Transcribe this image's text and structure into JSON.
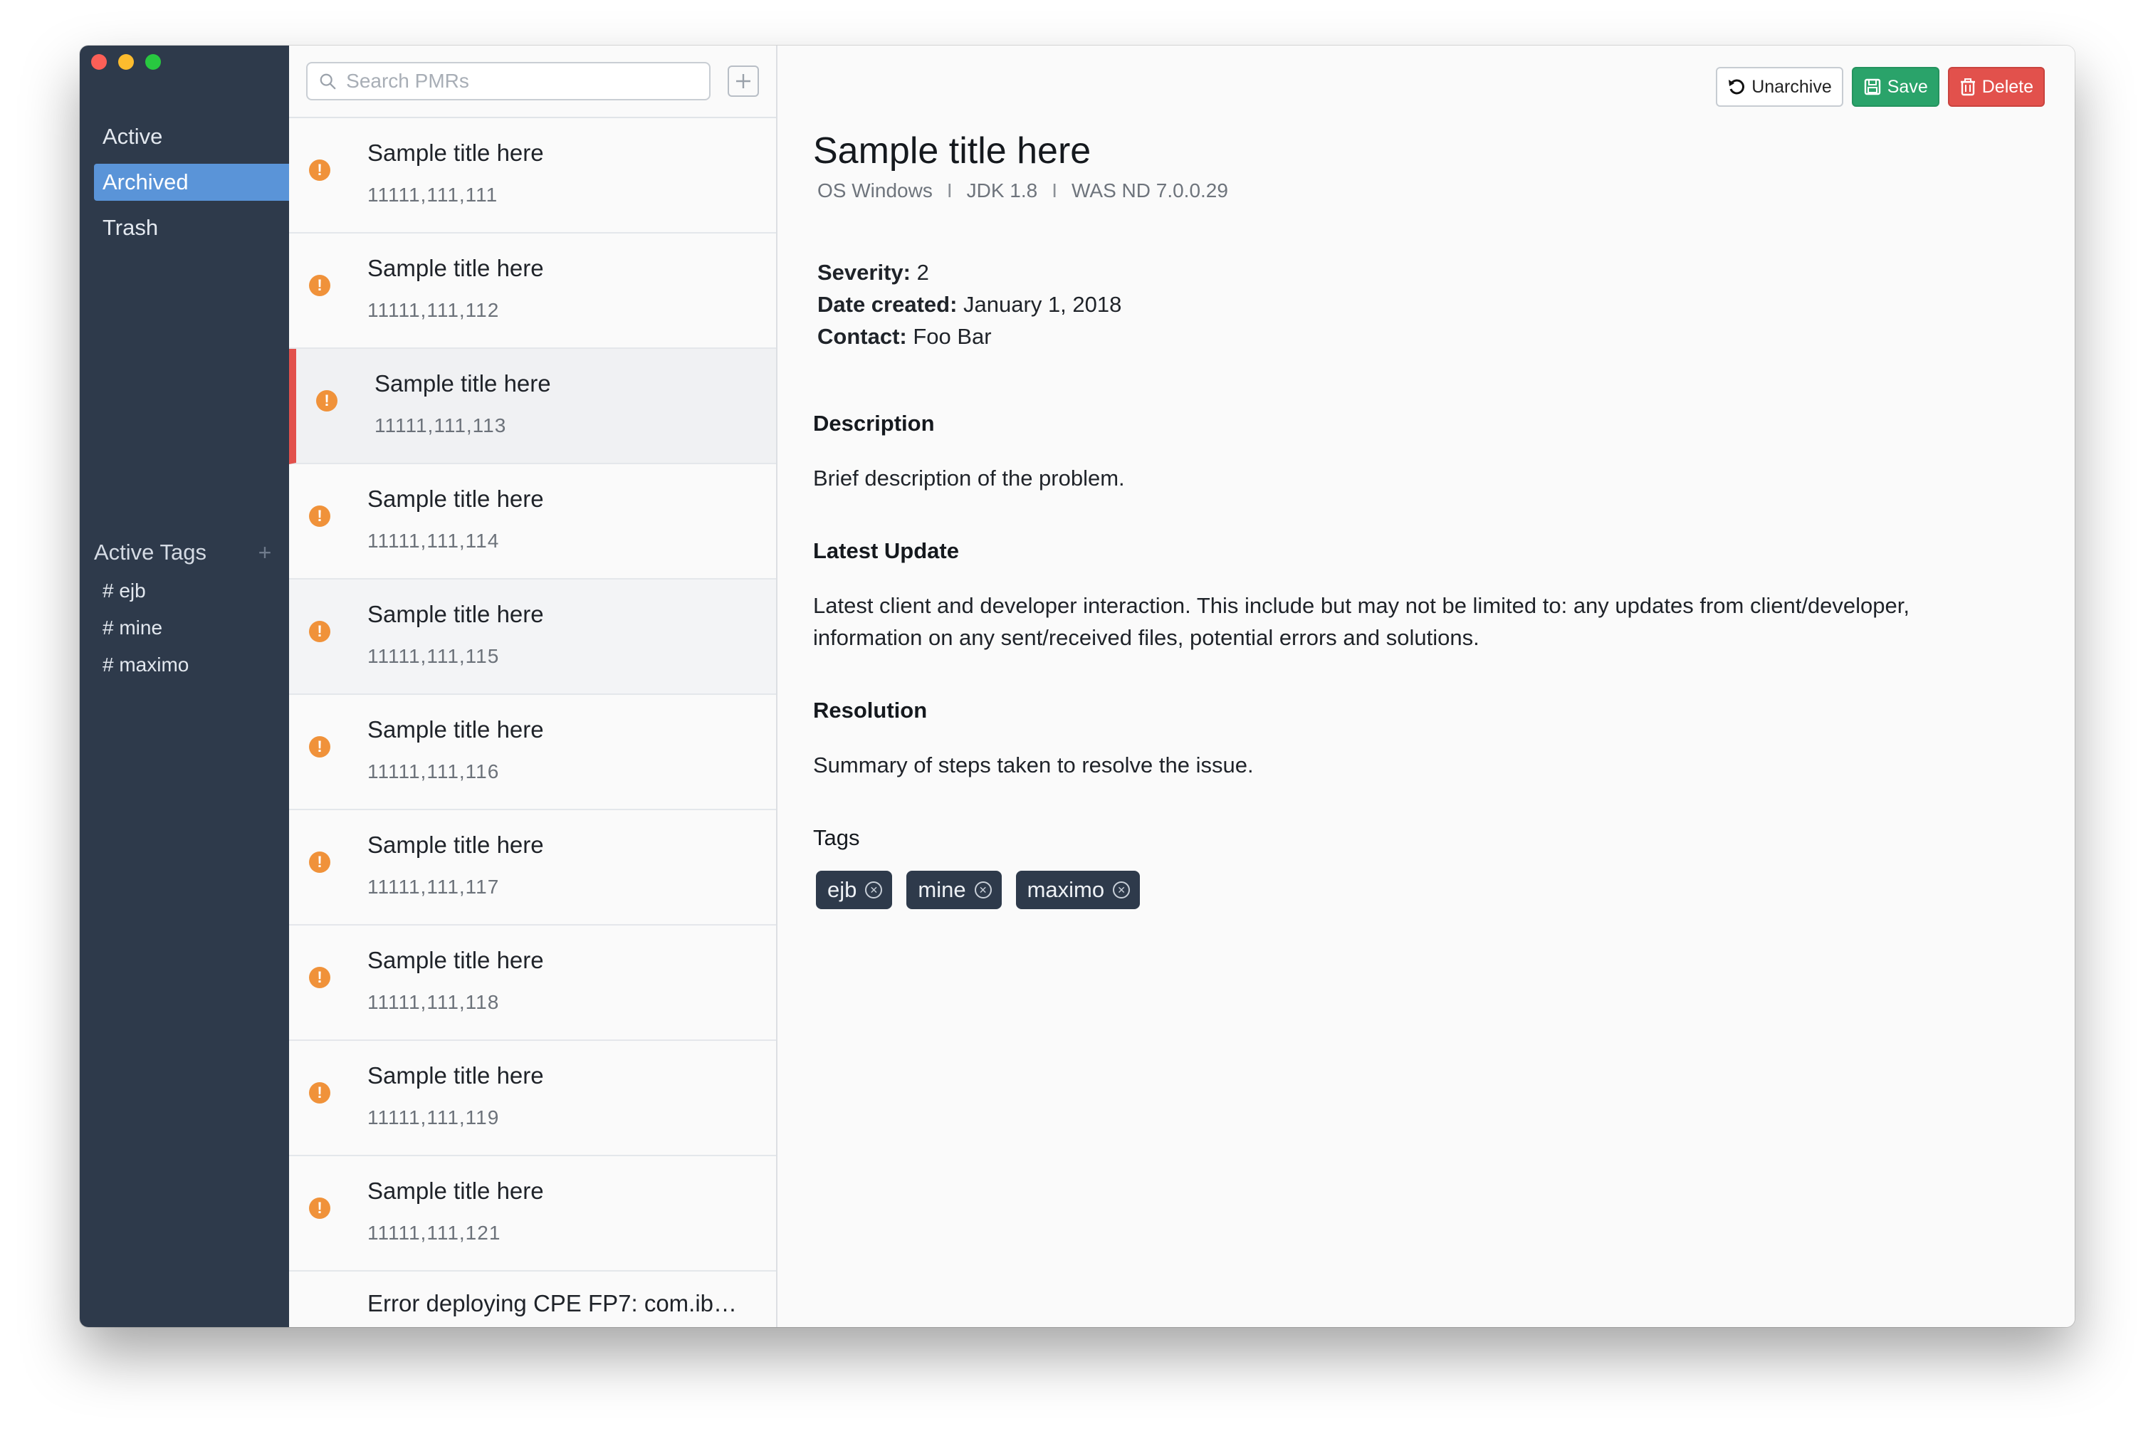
{
  "sidebar": {
    "nav": [
      {
        "label": "Active",
        "selected": false
      },
      {
        "label": "Archived",
        "selected": true
      },
      {
        "label": "Trash",
        "selected": false
      }
    ],
    "tags_title": "Active Tags",
    "tags_add": "+",
    "tags": [
      "# ejb",
      "# mine",
      "# maximo"
    ]
  },
  "list": {
    "search_placeholder": "Search PMRs",
    "items": [
      {
        "title": "Sample title here",
        "number": "11111,111,111"
      },
      {
        "title": "Sample title here",
        "number": "11111,111,112"
      },
      {
        "title": "Sample title here",
        "number": "11111,111,113"
      },
      {
        "title": "Sample title here",
        "number": "11111,111,114"
      },
      {
        "title": "Sample title here",
        "number": "11111,111,115"
      },
      {
        "title": "Sample title here",
        "number": "11111,111,116"
      },
      {
        "title": "Sample title here",
        "number": "11111,111,117"
      },
      {
        "title": "Sample title here",
        "number": "11111,111,118"
      },
      {
        "title": "Sample title here",
        "number": "11111,111,119"
      },
      {
        "title": "Sample title here",
        "number": "11111,111,121"
      },
      {
        "title": "Error deploying CPE FP7: com.ibm...",
        "number": ""
      }
    ]
  },
  "toolbar": {
    "unarchive_label": "Unarchive",
    "save_label": "Save",
    "delete_label": "Delete"
  },
  "detail": {
    "title": "Sample title here",
    "meta": [
      "OS Windows",
      "JDK 1.8",
      "WAS ND 7.0.0.29"
    ],
    "meta_sep": "I",
    "severity_label": "Severity:",
    "severity_value": "2",
    "date_label": "Date created:",
    "date_value": "January 1, 2018",
    "contact_label": "Contact:",
    "contact_value": "Foo Bar",
    "description_heading": "Description",
    "description_text": "Brief description of the problem.",
    "update_heading": "Latest Update",
    "update_text": "Latest client and developer interaction. This include but may not be limited to: any updates from client/developer, information on any sent/received files, potential errors and solutions.",
    "resolution_heading": "Resolution",
    "resolution_text": "Summary of steps taken to resolve the issue.",
    "tags_heading": "Tags",
    "tags": [
      "ejb",
      "mine",
      "maximo"
    ]
  },
  "colors": {
    "sidebar_bg": "#2e3a4b",
    "selection_blue": "#5a94d8",
    "save_green": "#2aa36a",
    "delete_red": "#e2514c",
    "alert_orange": "#f0923a"
  }
}
